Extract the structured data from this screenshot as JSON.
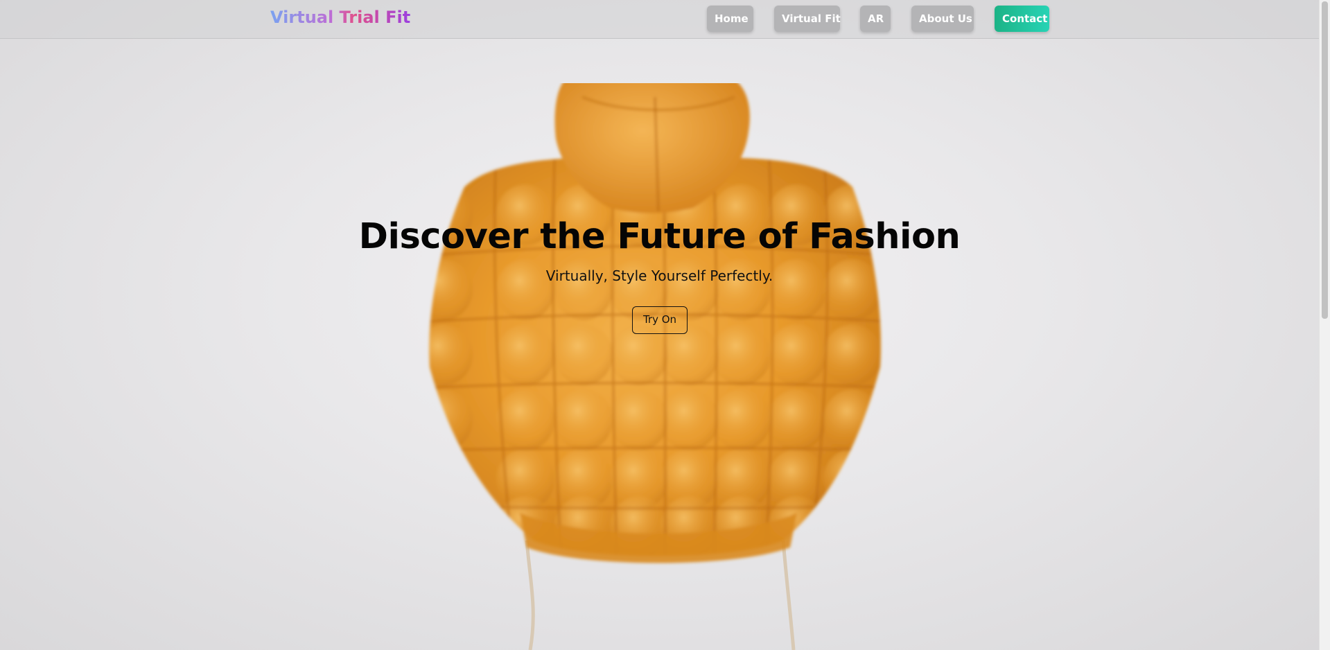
{
  "header": {
    "logo": "Virtual Trial Fit",
    "nav": [
      {
        "label": "Home"
      },
      {
        "label": "Virtual Fit"
      },
      {
        "label": "AR"
      },
      {
        "label": "About Us"
      },
      {
        "label": "Contact"
      }
    ]
  },
  "hero": {
    "title": "Discover the Future of Fashion",
    "subtitle": "Virtually, Style Yourself Perfectly.",
    "cta": "Try On",
    "image": "orange-puffer-jacket"
  },
  "colors": {
    "contact_gradient_start": "#1cb386",
    "contact_gradient_end": "#27d3b5",
    "nav_button": "#b4b4b6",
    "jacket": "#e79a2b"
  }
}
